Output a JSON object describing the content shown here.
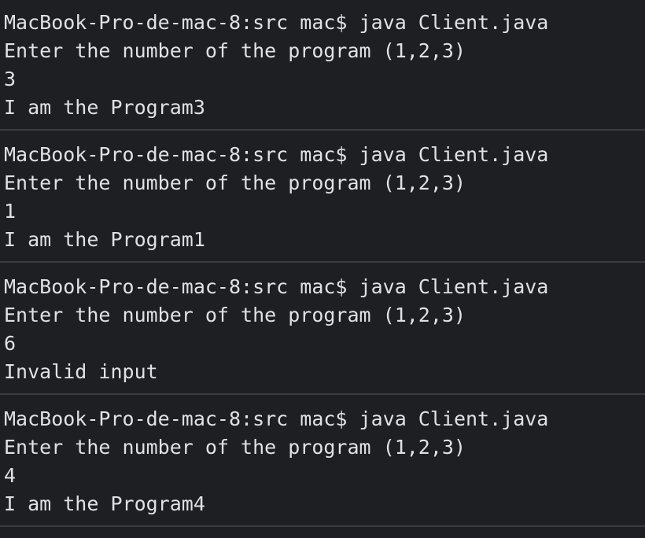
{
  "terminal": {
    "blocks": [
      {
        "prompt": "MacBook-Pro-de-mac-8:src mac$ java Client.java",
        "ask": "Enter the number of the program (1,2,3)",
        "input": "3",
        "output": "I am the Program3"
      },
      {
        "prompt": "MacBook-Pro-de-mac-8:src mac$ java Client.java",
        "ask": "Enter the number of the program (1,2,3)",
        "input": "1",
        "output": "I am the Program1"
      },
      {
        "prompt": "MacBook-Pro-de-mac-8:src mac$ java Client.java",
        "ask": "Enter the number of the program (1,2,3)",
        "input": "6",
        "output": "Invalid input"
      },
      {
        "prompt": "MacBook-Pro-de-mac-8:src mac$ java Client.java",
        "ask": "Enter the number of the program (1,2,3)",
        "input": "4",
        "output": "I am the Program4"
      }
    ]
  }
}
